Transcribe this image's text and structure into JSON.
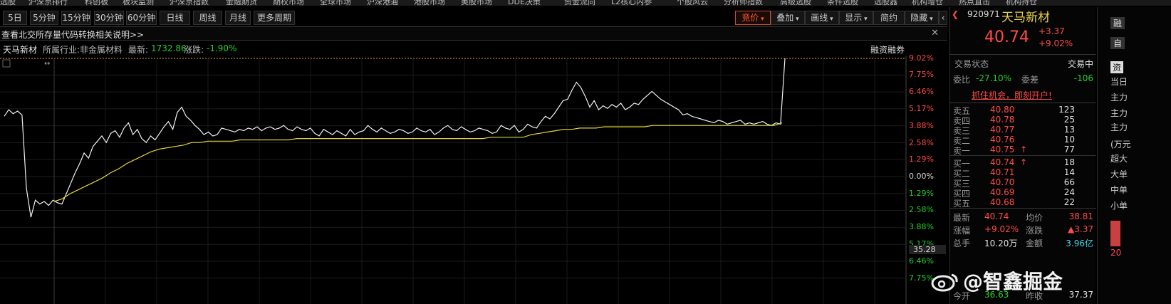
{
  "top_menu": [
    "选股",
    "沪深京排行",
    "科创板",
    "板块监测",
    "沪深京指数",
    "金融期货",
    "期权市场",
    "全球市场",
    "沪深港通",
    "港股市场",
    "美股市场",
    "DDE决策",
    "资金流向",
    "L2核心内参",
    "个股风云",
    "分析师指数",
    "高级选股",
    "条件选股",
    "选股器",
    "机构增仓",
    "热点直击",
    "机构持仓"
  ],
  "period_tabs": [
    "5日",
    "5分钟",
    "15分钟",
    "30分钟",
    "60分钟",
    "日线",
    "周线",
    "月线",
    "更多周期"
  ],
  "right_tools": {
    "bid": "竞价",
    "overlay": "叠加",
    "draw": "画线",
    "show": "显示",
    "simple": "简约",
    "hide": "隐藏"
  },
  "notice_text": "查看北交所存量代码转换相关说明>>",
  "info": {
    "name": "天马新材",
    "industry_label": "所属行业:",
    "industry": "非金属材料",
    "latest_label": "最新:",
    "latest": "1732.86",
    "change_label": "涨跌:",
    "change": "-1.90%",
    "margin": "融资融券"
  },
  "y_axis": {
    "top_pct": "9.02%",
    "up": [
      "7.75%",
      "6.46%",
      "5.17%",
      "3.88%",
      "2.58%",
      "1.29%"
    ],
    "zero": "0.00%",
    "down": [
      "1.29%",
      "2.58%",
      "3.88%",
      "5.17%",
      "6.46%",
      "7.75%"
    ],
    "cursor_value": "35.28"
  },
  "chart_data": {
    "type": "line",
    "title": "",
    "xlabel": "",
    "ylabel": "",
    "ylim": [
      -9.02,
      9.02
    ],
    "series": [
      {
        "values": [
          4.6,
          5.1,
          4.8,
          5.0,
          4.7,
          -0.9,
          -3.1,
          -1.8,
          -2.1,
          -1.9,
          -2.2,
          -1.8,
          -2.0,
          -2.1,
          -1.3,
          -0.5,
          0.3,
          1.0,
          1.8,
          1.4,
          2.3,
          2.7,
          3.1,
          2.6,
          3.3,
          3.5,
          3.0,
          3.7,
          4.1,
          3.2,
          3.6,
          2.9,
          2.6,
          3.1,
          2.8,
          3.3,
          3.8,
          4.2,
          3.6,
          4.9,
          5.3,
          4.6,
          4.3,
          3.9,
          3.6,
          3.2,
          3.4,
          3.1,
          3.2,
          3.7,
          3.6,
          3.5,
          3.4,
          3.6,
          3.5,
          3.7,
          3.6,
          3.8,
          3.5,
          3.7,
          3.8,
          3.6,
          3.7,
          3.9,
          3.6,
          3.5,
          3.8,
          3.6,
          3.5,
          3.7,
          3.3,
          3.1,
          3.6,
          3.4,
          3.2,
          3.5,
          3.3,
          3.1,
          3.6,
          3.2,
          3.4,
          3.5,
          3.9,
          3.6,
          3.4,
          3.7,
          3.5,
          3.3,
          3.4,
          3.6,
          3.5,
          3.3,
          3.4,
          3.7,
          3.5,
          3.4,
          3.6,
          3.2,
          3.4,
          3.7,
          3.9,
          3.6,
          3.5,
          3.8,
          3.6,
          3.4,
          3.5,
          3.7,
          3.6,
          3.5,
          3.3,
          3.4,
          3.9,
          3.7,
          3.6,
          3.9,
          3.4,
          3.6,
          4.0,
          3.8,
          3.7,
          4.2,
          4.6,
          4.4,
          4.8,
          5.3,
          5.8,
          5.9,
          6.6,
          7.2,
          6.8,
          6.1,
          5.3,
          5.8,
          5.1,
          5.4,
          5.2,
          5.5,
          5.3,
          5.6,
          5.1,
          5.3,
          5.6,
          5.5,
          5.9,
          6.2,
          6.5,
          6.2,
          5.9,
          5.7,
          5.5,
          5.3,
          5.1,
          4.7,
          4.8,
          4.6,
          4.5,
          4.4,
          4.3,
          4.2,
          4.1,
          4.3,
          4.2,
          4.0,
          4.1,
          4.2,
          4.3,
          4.0,
          4.1,
          4.0,
          4.1,
          4.2,
          4.0,
          3.9,
          4.1,
          4.0,
          9.02
        ]
      },
      {
        "values": [
          -1.9,
          -1.7,
          -1.3,
          -1.0,
          -0.7,
          -0.4,
          -0.1,
          0.3,
          0.6,
          1.0,
          1.3,
          1.6,
          1.9,
          2.1,
          2.2,
          2.3,
          2.4,
          2.6,
          2.6,
          2.7,
          2.7,
          2.7,
          2.7,
          2.8,
          2.8,
          2.8,
          2.8,
          2.8,
          2.8,
          2.8,
          2.9,
          2.9,
          2.9,
          2.9,
          2.9,
          2.9,
          2.9,
          2.9,
          2.9,
          2.9,
          2.9,
          2.9,
          2.9,
          2.9,
          2.9,
          2.9,
          2.9,
          2.9,
          2.9,
          2.9,
          2.9,
          2.9,
          2.9,
          2.9,
          3.0,
          3.0,
          3.0,
          3.0,
          3.0,
          3.2,
          3.3,
          3.4,
          3.5,
          3.6,
          3.6,
          3.7,
          3.7,
          3.7,
          3.8,
          3.8,
          3.8,
          3.8,
          3.8,
          3.8,
          3.9,
          3.9,
          3.9,
          3.9,
          3.9,
          3.9,
          3.9,
          3.9,
          3.9,
          3.9,
          3.9,
          3.9,
          3.9,
          3.9,
          3.9,
          3.9,
          4.1
        ]
      }
    ]
  },
  "quote": {
    "code": "920971",
    "name": "天马新材",
    "price": "40.74",
    "chg": "+3.37",
    "pct": "+9.02%",
    "status_label": "交易状态",
    "status": "交易中",
    "webi_label": "委比",
    "webi": "-27.10%",
    "weicha_label": "委差",
    "weicha": "-106",
    "promo": "抓住机会，即刻开户!",
    "asks": [
      {
        "label": "卖五",
        "price": "40.80",
        "vol": "123"
      },
      {
        "label": "卖四",
        "price": "40.78",
        "vol": "25"
      },
      {
        "label": "卖三",
        "price": "40.77",
        "vol": "13"
      },
      {
        "label": "卖二",
        "price": "40.76",
        "vol": "10"
      },
      {
        "label": "卖一",
        "price": "40.75",
        "vol": "77"
      }
    ],
    "bids": [
      {
        "label": "买一",
        "price": "40.74",
        "vol": "18"
      },
      {
        "label": "买二",
        "price": "40.71",
        "vol": "14"
      },
      {
        "label": "买三",
        "price": "40.70",
        "vol": "66"
      },
      {
        "label": "买四",
        "price": "40.69",
        "vol": "24"
      },
      {
        "label": "买五",
        "price": "40.68",
        "vol": "22"
      }
    ],
    "stats": [
      {
        "l1": "最新",
        "v1": "40.74",
        "l2": "均价",
        "v2": "38.81"
      },
      {
        "l1": "涨幅",
        "v1": "+9.02%",
        "l2": "涨跌",
        "v2": "▲3.37"
      },
      {
        "l1": "总手",
        "v1": "10.20万",
        "l2": "金额",
        "v2": "3.96亿"
      },
      {
        "l1": "今开",
        "v1": "36.63",
        "l2": "昨收",
        "v2": "37.37"
      }
    ]
  },
  "far_right": {
    "top1": "融",
    "top2": "自",
    "items": [
      "资",
      "当日",
      "主力",
      "主力",
      "主力",
      "(万元",
      "超大",
      "大单",
      "中单",
      "小单",
      "20"
    ]
  },
  "watermark": "@智鑫掘金"
}
